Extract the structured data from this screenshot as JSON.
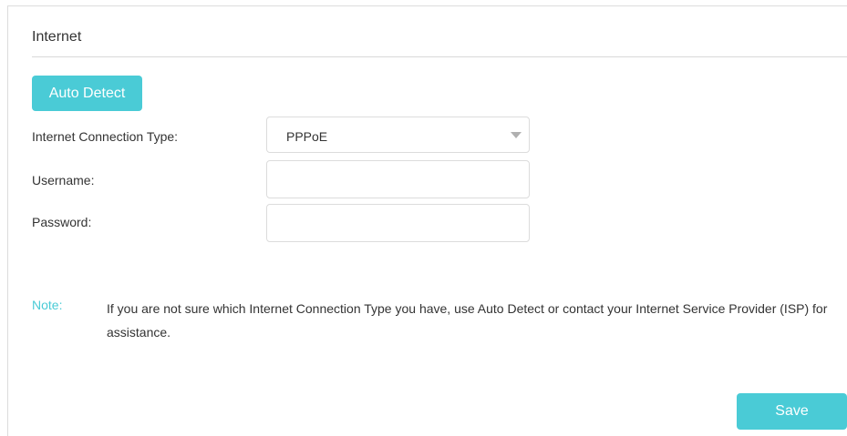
{
  "section": {
    "title": "Internet"
  },
  "auto_detect": {
    "label": "Auto Detect"
  },
  "form": {
    "connection_type": {
      "label": "Internet Connection Type:",
      "value": "PPPoE"
    },
    "username": {
      "label": "Username:",
      "value": ""
    },
    "password": {
      "label": "Password:",
      "value": ""
    }
  },
  "note": {
    "label": "Note:",
    "text": "If you are not sure which Internet Connection Type you have, use Auto Detect or contact your Internet Service Provider (ISP) for assistance."
  },
  "footer": {
    "save_label": "Save"
  },
  "colors": {
    "accent": "#4acbd6",
    "border": "#dcdcdc",
    "text": "#333333"
  },
  "icons": {
    "select_caret": "chevron-down-icon"
  }
}
